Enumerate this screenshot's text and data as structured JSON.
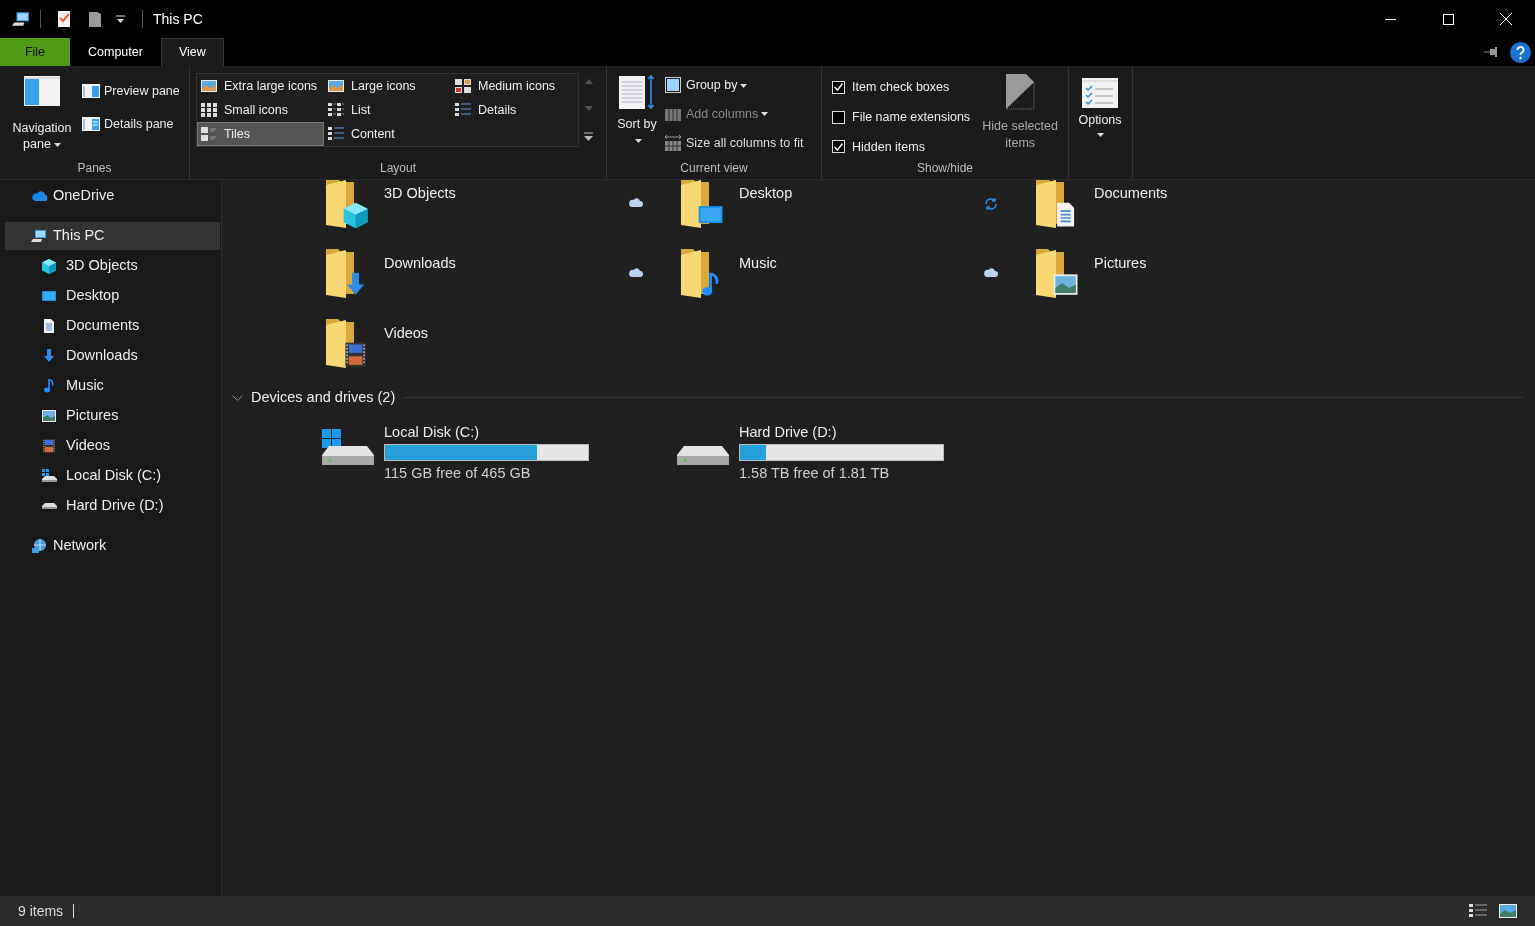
{
  "window": {
    "title": "This PC"
  },
  "ribbon_tabs": [
    {
      "label": "File",
      "kind": "file",
      "selected": false
    },
    {
      "label": "Computer",
      "kind": "tab",
      "selected": false
    },
    {
      "label": "View",
      "kind": "tab",
      "selected": true
    }
  ],
  "ribbon": {
    "panes": {
      "label": "Panes",
      "navigation_pane": "Navigation pane",
      "preview_pane": "Preview pane",
      "details_pane": "Details pane"
    },
    "layout": {
      "label": "Layout",
      "options": [
        {
          "label": "Extra large icons",
          "kind": "thumb",
          "selected": false
        },
        {
          "label": "Large icons",
          "kind": "thumb",
          "selected": false
        },
        {
          "label": "Medium icons",
          "kind": "grid4",
          "selected": false
        },
        {
          "label": "Small icons",
          "kind": "grid9",
          "selected": false
        },
        {
          "label": "List",
          "kind": "list",
          "selected": false
        },
        {
          "label": "Details",
          "kind": "details",
          "selected": false
        },
        {
          "label": "Tiles",
          "kind": "tiles",
          "selected": true
        },
        {
          "label": "Content",
          "kind": "details",
          "selected": false
        }
      ]
    },
    "current_view": {
      "label": "Current view",
      "sort_by": "Sort by",
      "group_by": "Group by",
      "add_columns": {
        "label": "Add columns",
        "disabled": true
      },
      "size_columns": "Size all columns to fit"
    },
    "show_hide": {
      "label": "Show/hide",
      "checkboxes": [
        {
          "label": "Item check boxes",
          "checked": true
        },
        {
          "label": "File name extensions",
          "checked": false
        },
        {
          "label": "Hidden items",
          "checked": true
        }
      ],
      "hide_selected": {
        "label": "Hide selected items",
        "disabled": true
      }
    },
    "options": {
      "label": "Options"
    }
  },
  "nav_pane": {
    "items": [
      {
        "label": "OneDrive",
        "kind": "onedrive",
        "selected": false
      },
      {
        "label": "This PC",
        "kind": "pc",
        "selected": true,
        "children": [
          {
            "label": "3D Objects",
            "kind": "cube",
            "selected": false
          },
          {
            "label": "Desktop",
            "kind": "desktop",
            "selected": false
          },
          {
            "label": "Documents",
            "kind": "documents",
            "selected": false
          },
          {
            "label": "Downloads",
            "kind": "downloads",
            "selected": false
          },
          {
            "label": "Music",
            "kind": "music",
            "selected": false
          },
          {
            "label": "Pictures",
            "kind": "pictures",
            "selected": false
          },
          {
            "label": "Videos",
            "kind": "videos",
            "selected": false
          },
          {
            "label": "Local Disk (C:)",
            "kind": "windowsdrive",
            "selected": false
          },
          {
            "label": "Hard Drive (D:)",
            "kind": "drive",
            "selected": false
          }
        ]
      },
      {
        "label": "Network",
        "kind": "network",
        "selected": false
      }
    ]
  },
  "folders": [
    {
      "name": "3D Objects",
      "kind": "cube",
      "cloud": true,
      "syncing": false
    },
    {
      "name": "Desktop",
      "kind": "desktop",
      "cloud": false,
      "syncing": true
    },
    {
      "name": "Documents",
      "kind": "documents",
      "cloud": false,
      "syncing": false
    },
    {
      "name": "Downloads",
      "kind": "downloads",
      "cloud": true,
      "syncing": false
    },
    {
      "name": "Music",
      "kind": "music",
      "cloud": true,
      "syncing": false
    },
    {
      "name": "Pictures",
      "kind": "pictures",
      "cloud": false,
      "syncing": false
    },
    {
      "name": "Videos",
      "kind": "videos",
      "cloud": false,
      "syncing": false
    }
  ],
  "devices": {
    "header": "Devices and drives (2)",
    "expanded": true,
    "drives": [
      {
        "name": "Local Disk (C:)",
        "kind": "windowsdrive",
        "level": 0.75,
        "free": "115 GB free of 465 GB"
      },
      {
        "name": "Hard Drive (D:)",
        "kind": "drive",
        "level": 0.13,
        "free": "1.58 TB free of 1.81 TB"
      }
    ]
  },
  "status_bar": {
    "items": "9 items"
  }
}
